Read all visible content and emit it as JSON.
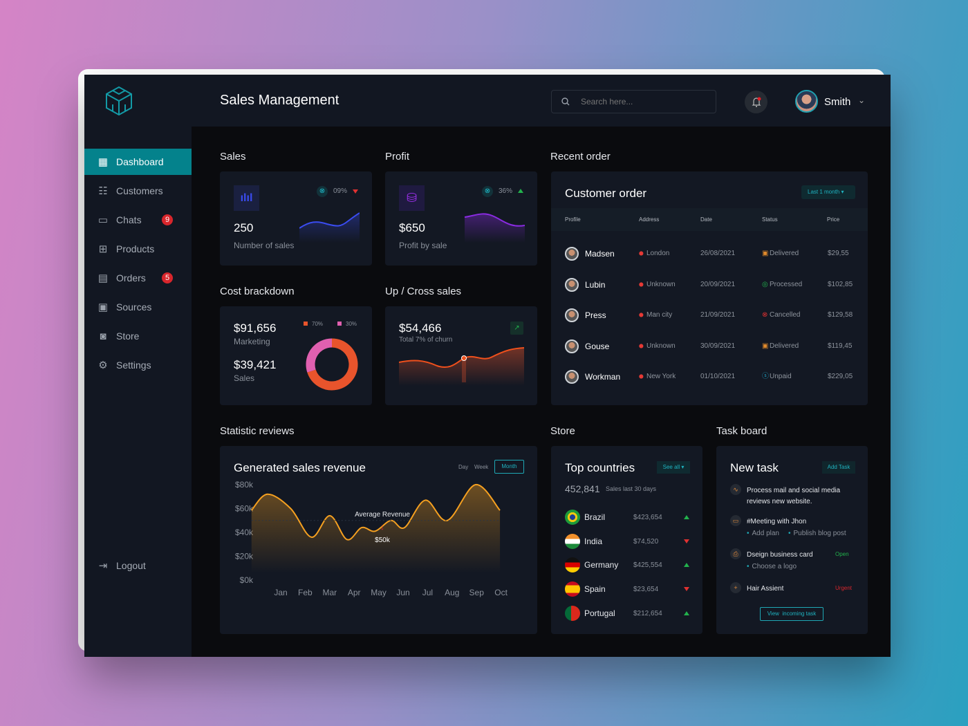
{
  "header": {
    "title": "Sales Management",
    "search_placeholder": "Search here...",
    "user_name": "Smith"
  },
  "sidebar": {
    "items": [
      {
        "label": "Dashboard",
        "icon": "dashboard-icon",
        "active": true
      },
      {
        "label": "Customers",
        "icon": "customers-icon"
      },
      {
        "label": "Chats",
        "icon": "chat-icon",
        "badge": "9"
      },
      {
        "label": "Products",
        "icon": "gift-icon"
      },
      {
        "label": "Orders",
        "icon": "clipboard-icon",
        "badge": "5"
      },
      {
        "label": "Sources",
        "icon": "folder-icon"
      },
      {
        "label": "Store",
        "icon": "bag-icon"
      },
      {
        "label": "Settings",
        "icon": "gear-icon"
      }
    ],
    "logout": "Logout"
  },
  "sales": {
    "section": "Sales",
    "value": "250",
    "label": "Number of sales",
    "change": "09%",
    "trend": "down",
    "color": "#3a4cf0"
  },
  "profit": {
    "section": "Profit",
    "value": "$650",
    "label": "Profit by sale",
    "change": "36%",
    "trend": "up",
    "color": "#8a2be2"
  },
  "cost": {
    "section": "Cost brackdown",
    "marketing_value": "$91,656",
    "marketing_label": "Marketing",
    "sales_value": "$39,421",
    "sales_label": "Sales",
    "legend": [
      {
        "label": "70%",
        "value": 70,
        "color": "#e8542c"
      },
      {
        "label": "30%",
        "value": 30,
        "color": "#e060b0"
      }
    ]
  },
  "cross": {
    "section": "Up / Cross sales",
    "value": "$54,466",
    "label": "Total 7% of churn"
  },
  "orders": {
    "section": "Recent order",
    "title": "Customer order",
    "filter": "Last 1 month",
    "columns": [
      "Profile",
      "Address",
      "Date",
      "Status",
      "Price"
    ],
    "rows": [
      {
        "name": "Madsen",
        "address": "London",
        "date": "26/08/2021",
        "status": "Delivered",
        "status_color": "#e08a2c",
        "price": "$29,55"
      },
      {
        "name": "Lubin",
        "address": "Unknown",
        "date": "20/09/2021",
        "status": "Processed",
        "status_color": "#22b14c",
        "price": "$102,85"
      },
      {
        "name": "Press",
        "address": "Man city",
        "date": "21/09/2021",
        "status": "Cancelled",
        "status_color": "#e03131",
        "price": "$129,58"
      },
      {
        "name": "Gouse",
        "address": "Unknown",
        "date": "30/09/2021",
        "status": "Delivered",
        "status_color": "#e08a2c",
        "price": "$119,45"
      },
      {
        "name": "Workman",
        "address": "New York",
        "date": "01/10/2021",
        "status": "Unpaid",
        "status_color": "#1f9fc0",
        "price": "$229,05"
      }
    ]
  },
  "stats": {
    "section": "Statistic reviews",
    "title": "Generated sales revenue",
    "tabs": [
      "Day",
      "Week",
      "Month"
    ],
    "active_tab": "Month",
    "annotation_label": "Average Revenue",
    "annotation_value": "$50k"
  },
  "chart_data": {
    "type": "area",
    "x": [
      "Jan",
      "Feb",
      "Mar",
      "Apr",
      "May",
      "Jun",
      "Jul",
      "Aug",
      "Sep",
      "Oct"
    ],
    "yticks": [
      "$80k",
      "$60k",
      "$40k",
      "$20k",
      "$0k"
    ],
    "ylim": [
      0,
      80000
    ],
    "points": [
      [
        -0.6,
        58500
      ],
      [
        0.05,
        72000
      ],
      [
        1.0,
        60000
      ],
      [
        1.85,
        36000
      ],
      [
        2.6,
        54000
      ],
      [
        3.3,
        34000
      ],
      [
        3.9,
        44000
      ],
      [
        4.45,
        41000
      ],
      [
        5.1,
        50000
      ],
      [
        5.65,
        44000
      ],
      [
        6.5,
        67000
      ],
      [
        7.4,
        50000
      ],
      [
        8.55,
        80000
      ],
      [
        9.55,
        58500
      ]
    ],
    "average": 50000,
    "color": "#f5a020",
    "grid": false
  },
  "store": {
    "section": "Store",
    "title": "Top countries",
    "see_all": "See all",
    "total": "452,841",
    "total_label": "Sales last 30 days",
    "countries": [
      {
        "name": "Brazil",
        "value": "$423,654",
        "trend": "up"
      },
      {
        "name": "India",
        "value": "$74,520",
        "trend": "down"
      },
      {
        "name": "Germany",
        "value": "$425,554",
        "trend": "up"
      },
      {
        "name": "Spain",
        "value": "$23,654",
        "trend": "down"
      },
      {
        "name": "Portugal",
        "value": "$212,654",
        "trend": "up"
      }
    ]
  },
  "tasks": {
    "section": "Task board",
    "title": "New task",
    "add": "Add Task",
    "view": "View  incoming task",
    "items": [
      {
        "title": "Process mail and social media reviews new website.",
        "icon": "activity-icon"
      },
      {
        "title": "#Meeting with Jhon",
        "icon": "video-icon",
        "subs": [
          "Add plan",
          "Publish blog post"
        ]
      },
      {
        "title": "Dseign business card",
        "icon": "printer-icon",
        "tag": "Open",
        "tag_color": "#22b14c",
        "subs": [
          "Choose a logo"
        ]
      },
      {
        "title": "Hair Assient",
        "icon": "plus-icon",
        "tag": "Urgent",
        "tag_color": "#d8262c"
      }
    ]
  }
}
